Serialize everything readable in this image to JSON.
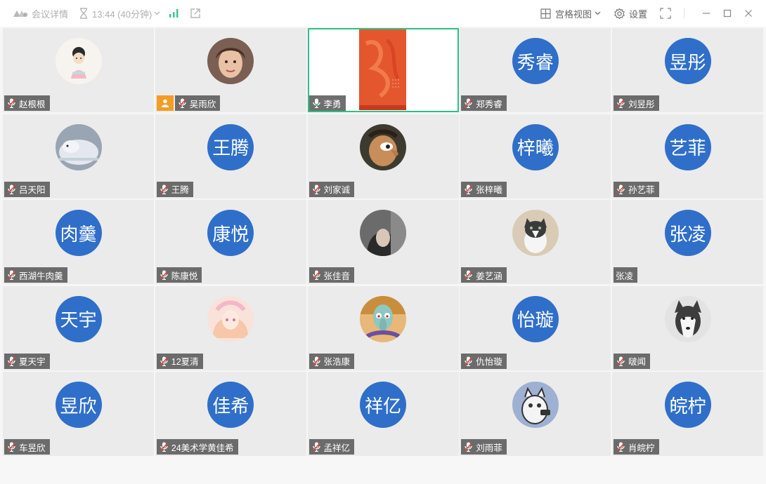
{
  "titlebar": {
    "meeting_info_label": "会议详情",
    "time_label": "13:44 (40分钟)",
    "view_mode_label": "宫格视图",
    "settings_label": "设置"
  },
  "colors": {
    "avatar_blue": "#2f6fc9",
    "active_border": "#2fbf86",
    "host_badge": "#f39c26",
    "signal_green": "#3cc78a"
  },
  "participants": [
    {
      "name": "赵根根",
      "avatar_type": "image",
      "avatar_desc": "cartoon-girl",
      "mic": "muted"
    },
    {
      "name": "吴雨欣",
      "avatar_type": "image",
      "avatar_desc": "child-photo",
      "mic": "muted",
      "host": true
    },
    {
      "name": "李勇",
      "avatar_type": "screen",
      "avatar_desc": "red-screen-share",
      "mic": "speaking",
      "active": true
    },
    {
      "name": "郑秀睿",
      "avatar_type": "text",
      "avatar_text": "秀睿",
      "mic": "muted"
    },
    {
      "name": "刘昱彤",
      "avatar_type": "text",
      "avatar_text": "昱彤",
      "mic": "muted"
    },
    {
      "name": "吕天阳",
      "avatar_type": "image",
      "avatar_desc": "polar-bear",
      "mic": "muted"
    },
    {
      "name": "王腾",
      "avatar_type": "text",
      "avatar_text": "王腾",
      "mic": "muted"
    },
    {
      "name": "刘家诚",
      "avatar_type": "image",
      "avatar_desc": "cartoon-character",
      "mic": "muted"
    },
    {
      "name": "张梓曦",
      "avatar_type": "text",
      "avatar_text": "梓曦",
      "mic": "muted"
    },
    {
      "name": "孙艺菲",
      "avatar_type": "text",
      "avatar_text": "艺菲",
      "mic": "muted"
    },
    {
      "name": "西湖牛肉羹",
      "avatar_type": "text",
      "avatar_text": "肉羹",
      "mic": "muted"
    },
    {
      "name": "陈康悦",
      "avatar_type": "text",
      "avatar_text": "康悦",
      "mic": "muted"
    },
    {
      "name": "张佳音",
      "avatar_type": "image",
      "avatar_desc": "hooded-person",
      "mic": "muted"
    },
    {
      "name": "姜艺涵",
      "avatar_type": "image",
      "avatar_desc": "cat-photo",
      "mic": "muted"
    },
    {
      "name": "张凌",
      "avatar_type": "text",
      "avatar_text": "张凌",
      "mic": "none"
    },
    {
      "name": "夏天宇",
      "avatar_type": "text",
      "avatar_text": "天宇",
      "mic": "muted"
    },
    {
      "name": "12夏清",
      "avatar_type": "image",
      "avatar_desc": "anime-girl",
      "mic": "muted"
    },
    {
      "name": "张浩康",
      "avatar_type": "image",
      "avatar_desc": "squidward-cartoon",
      "mic": "muted"
    },
    {
      "name": "仇怡璇",
      "avatar_type": "text",
      "avatar_text": "怡璇",
      "mic": "muted"
    },
    {
      "name": "啵闻",
      "avatar_type": "image",
      "avatar_desc": "husky-dog",
      "mic": "muted"
    },
    {
      "name": "车昱欣",
      "avatar_type": "text",
      "avatar_text": "昱欣",
      "mic": "muted"
    },
    {
      "name": "24美术学黄佳希",
      "avatar_type": "text",
      "avatar_text": "佳希",
      "mic": "muted"
    },
    {
      "name": "孟祥亿",
      "avatar_type": "text",
      "avatar_text": "祥亿",
      "mic": "muted"
    },
    {
      "name": "刘雨菲",
      "avatar_type": "image",
      "avatar_desc": "cartoon-cat-phone",
      "mic": "muted"
    },
    {
      "name": "肖皖柠",
      "avatar_type": "text",
      "avatar_text": "皖柠",
      "mic": "muted"
    }
  ]
}
